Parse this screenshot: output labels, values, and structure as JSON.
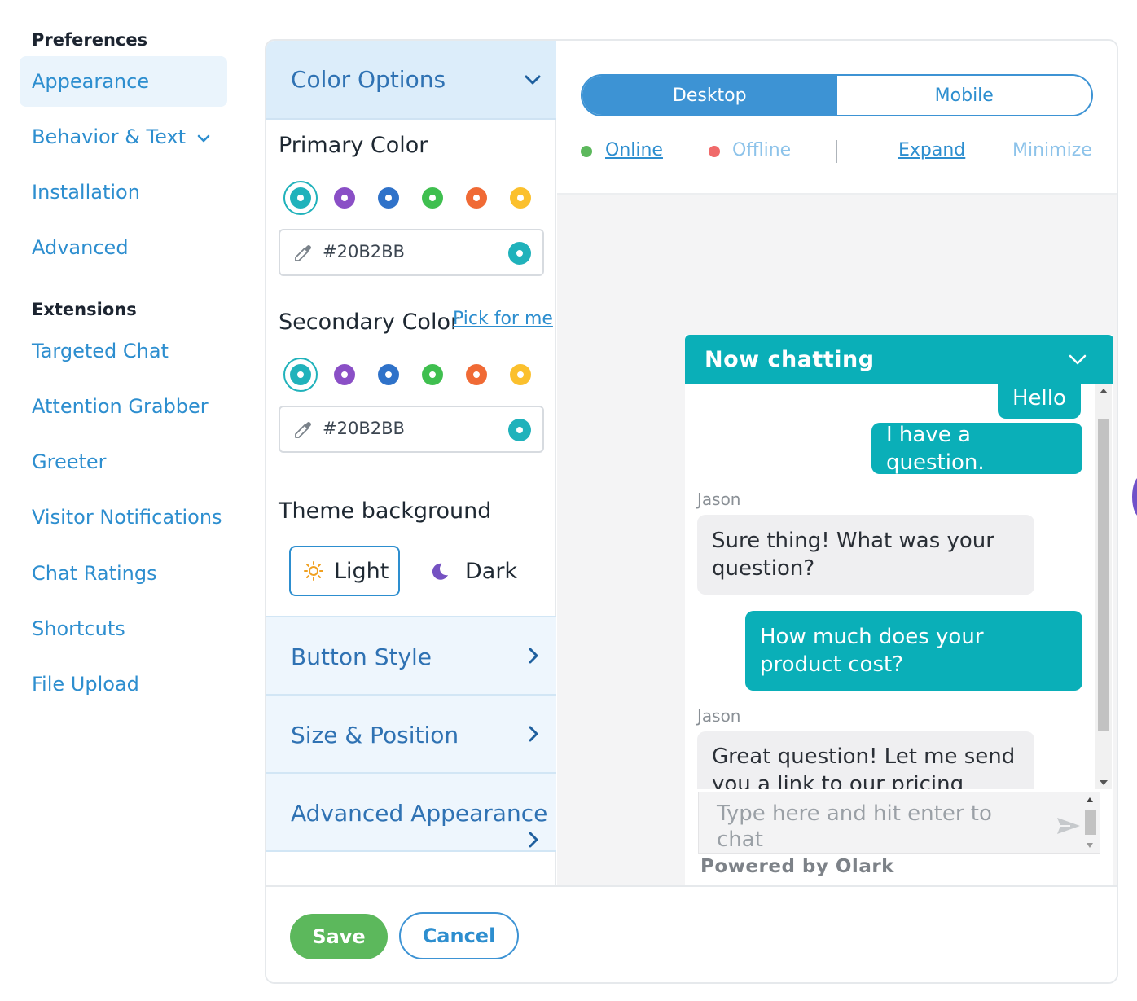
{
  "nav": {
    "preferences_heading": "Preferences",
    "preferences_items": [
      "Appearance",
      "Behavior & Text",
      "Installation",
      "Advanced"
    ],
    "extensions_heading": "Extensions",
    "extensions_items": [
      "Targeted Chat",
      "Attention Grabber",
      "Greeter",
      "Visitor Notifications",
      "Chat Ratings",
      "Shortcuts",
      "File Upload"
    ]
  },
  "settings": {
    "color_options": {
      "title": "Color Options"
    },
    "primary_color": {
      "label": "Primary Color",
      "value": "#20B2BB"
    },
    "secondary_color": {
      "label": "Secondary Color",
      "pick_link": "Pick for me",
      "value": "#20B2BB"
    },
    "swatches": [
      "#20b2bb",
      "#8a4fc6",
      "#2f72c9",
      "#3fbf4f",
      "#f06a35",
      "#fbc02d"
    ],
    "theme": {
      "label": "Theme background",
      "light": "Light",
      "dark": "Dark",
      "selected": "Light"
    },
    "sections": [
      "Button Style",
      "Size & Position",
      "Advanced Appearance"
    ]
  },
  "preview": {
    "tabs": {
      "desktop": "Desktop",
      "mobile": "Mobile",
      "selected": "Desktop"
    },
    "states": {
      "online": "Online",
      "offline": "Offline",
      "expand": "Expand",
      "minimize": "Minimize"
    },
    "colors": {
      "online": "#5cb85c",
      "offline": "#f06a6a"
    }
  },
  "chat": {
    "header": "Now chatting",
    "messages": [
      {
        "from": "visitor",
        "text": "Hello"
      },
      {
        "from": "visitor",
        "text": "I have a question."
      },
      {
        "from": "operator",
        "name": "Jason",
        "text": "Sure thing! What was your question?"
      },
      {
        "from": "visitor",
        "text": "How much does your product cost?"
      },
      {
        "from": "operator",
        "name": "Jason",
        "text": "Great question! Let me send you a link to our pricing"
      }
    ],
    "input_placeholder": "Type here and hit enter to chat",
    "powered_by": "Powered by Olark"
  },
  "footer": {
    "save": "Save",
    "cancel": "Cancel"
  },
  "theme_colors": {
    "primary": "#20b2bb",
    "link": "#2d8ecf",
    "save": "#5cb85c"
  }
}
